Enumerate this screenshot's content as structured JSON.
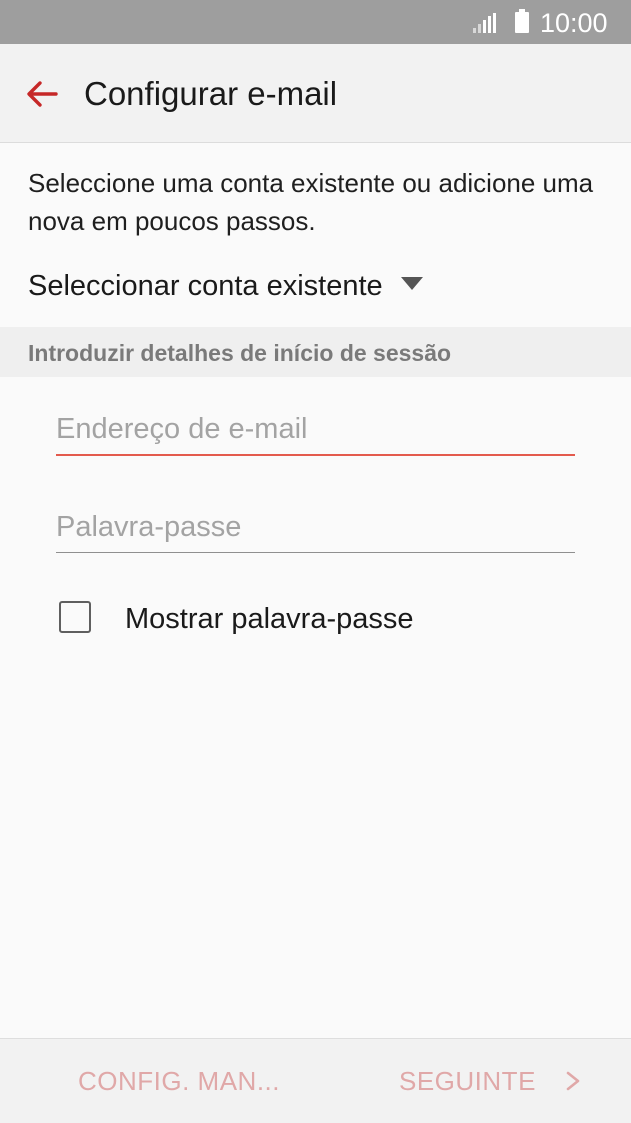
{
  "status_bar": {
    "time": "10:00",
    "icons": [
      "signal-icon",
      "battery-icon"
    ]
  },
  "app_bar": {
    "title": "Configurar e-mail",
    "back_icon": "arrow-left-icon"
  },
  "intro_text": "Seleccione uma conta existente ou adicione uma nova em poucos passos.",
  "account_select": {
    "label": "Seleccionar conta existente",
    "icon": "triangle-down-icon"
  },
  "section_header": "Introduzir detalhes de início de sessão",
  "email_field": {
    "placeholder": "Endereço de e-mail",
    "value": ""
  },
  "password_field": {
    "placeholder": "Palavra-passe",
    "value": ""
  },
  "show_password": {
    "label": "Mostrar palavra-passe",
    "checked": false
  },
  "bottom_bar": {
    "manual_label": "CONFIG. MAN...",
    "next_label": "SEGUINTE",
    "next_icon": "chevron-right-icon"
  },
  "colors": {
    "accent": "#c62828",
    "field_focus_underline": "#e35a4d",
    "disabled_button": "#e0a8a8",
    "status_bar": "#9e9e9e"
  }
}
